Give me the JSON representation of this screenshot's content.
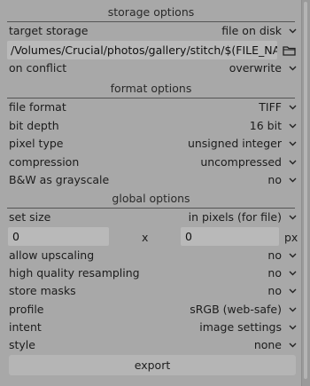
{
  "storage": {
    "header": "storage options",
    "target_storage_label": "target storage",
    "target_storage_value": "file on disk",
    "path": "/Volumes/Crucial/photos/gallery/stitch/$(FILE_NAME)",
    "on_conflict_label": "on conflict",
    "on_conflict_value": "overwrite"
  },
  "format": {
    "header": "format options",
    "file_format_label": "file format",
    "file_format_value": "TIFF",
    "bit_depth_label": "bit depth",
    "bit_depth_value": "16 bit",
    "pixel_type_label": "pixel type",
    "pixel_type_value": "unsigned integer",
    "compression_label": "compression",
    "compression_value": "uncompressed",
    "bw_label": "B&W as grayscale",
    "bw_value": "no"
  },
  "global": {
    "header": "global options",
    "set_size_label": "set size",
    "set_size_value": "in pixels (for file)",
    "width_value": "0",
    "x_label": "x",
    "height_value": "0",
    "unit_label": "px",
    "upscaling_label": "allow upscaling",
    "upscaling_value": "no",
    "hq_label": "high quality resampling",
    "hq_value": "no",
    "masks_label": "store masks",
    "masks_value": "no",
    "profile_label": "profile",
    "profile_value": "sRGB (web-safe)",
    "intent_label": "intent",
    "intent_value": "image settings",
    "style_label": "style",
    "style_value": "none"
  },
  "export_label": "export",
  "icons": {
    "dropdown": "chevron-down-icon",
    "folder": "folder-icon"
  }
}
